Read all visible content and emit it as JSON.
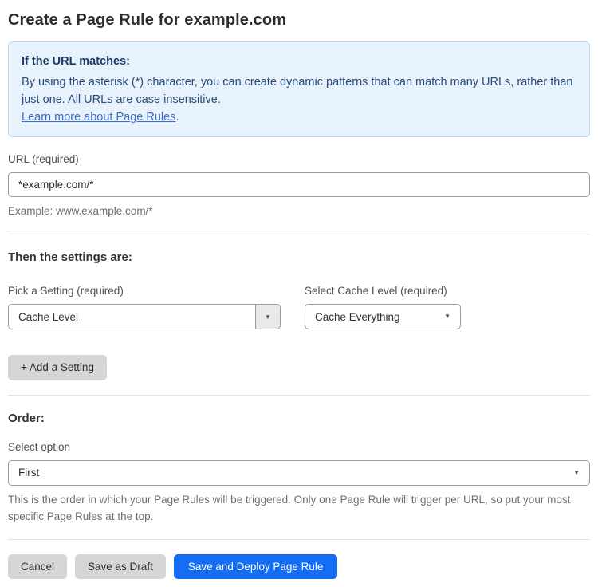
{
  "page": {
    "title": "Create a Page Rule for example.com"
  },
  "info_box": {
    "heading": "If the URL matches:",
    "body": "By using the asterisk (*) character, you can create dynamic patterns that can match many URLs, rather than just one. All URLs are case insensitive.",
    "link": "Learn more about Page Rules",
    "link_suffix": "."
  },
  "url_field": {
    "label": "URL (required)",
    "value": "*example.com/*",
    "help": "Example: www.example.com/*"
  },
  "settings": {
    "heading": "Then the settings are:",
    "setting_label": "Pick a Setting (required)",
    "setting_value": "Cache Level",
    "cache_label": "Select Cache Level (required)",
    "cache_value": "Cache Everything",
    "add_button_label": "+ Add a Setting",
    "dropdown_arrow": "▼"
  },
  "order": {
    "heading": "Order:",
    "label": "Select option",
    "value": "First",
    "help": "This is the order in which your Page Rules will be triggered. Only one Page Rule will trigger per URL, so put your most specific Page Rules at the top.",
    "dropdown_arrow": "▼"
  },
  "actions": {
    "cancel_label": "Cancel",
    "save_draft_label": "Save as Draft",
    "save_deploy_label": "Save and Deploy Page Rule"
  },
  "colors": {
    "primary_button_blue": "#146ef5",
    "info_box_background": "#e8f2fd",
    "info_box_border": "#bcd6f3",
    "info_heading_text": "#1b3a66",
    "info_body_text": "#2a4a78",
    "link_blue": "#3a6dcb",
    "gray_button": "#d6d6d6"
  }
}
